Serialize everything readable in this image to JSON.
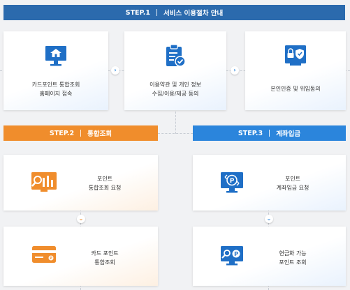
{
  "top_bar": {
    "step": "STEP.1",
    "title": "서비스 이용절차 안내"
  },
  "step2_bar": {
    "step": "STEP.2",
    "title": "통합조회"
  },
  "step3_bar": {
    "step": "STEP.3",
    "title": "계좌입금"
  },
  "step1_cards": [
    {
      "label": "카드포인트 통합조회\n홈페이지 접속",
      "icon": "monitor-home-icon"
    },
    {
      "label": "이용약관 및 개인 정보\n수집/이용/제공 동의",
      "icon": "clipboard-check-icon"
    },
    {
      "label": "본인인증 및 위임동의",
      "icon": "lock-shield-icon"
    }
  ],
  "step2_cards": [
    {
      "label": "포인트\n통합조회 요청",
      "icon": "chart-search-icon"
    },
    {
      "label": "카드 포인트\n통합조회",
      "icon": "credit-card-icon"
    }
  ],
  "step3_cards": [
    {
      "label": "포인트\n계좌입금 요청",
      "icon": "point-transfer-icon"
    },
    {
      "label": "현금화 가능\n포인트 조회",
      "icon": "point-search-icon"
    }
  ],
  "arrows": {
    "right": "›",
    "down": "⌄"
  },
  "colors": {
    "blue_dark": "#2b6aad",
    "blue": "#2b85dc",
    "orange": "#f08d2c",
    "icon_blue": "#1f6fc6",
    "icon_orange": "#f08d2c"
  }
}
